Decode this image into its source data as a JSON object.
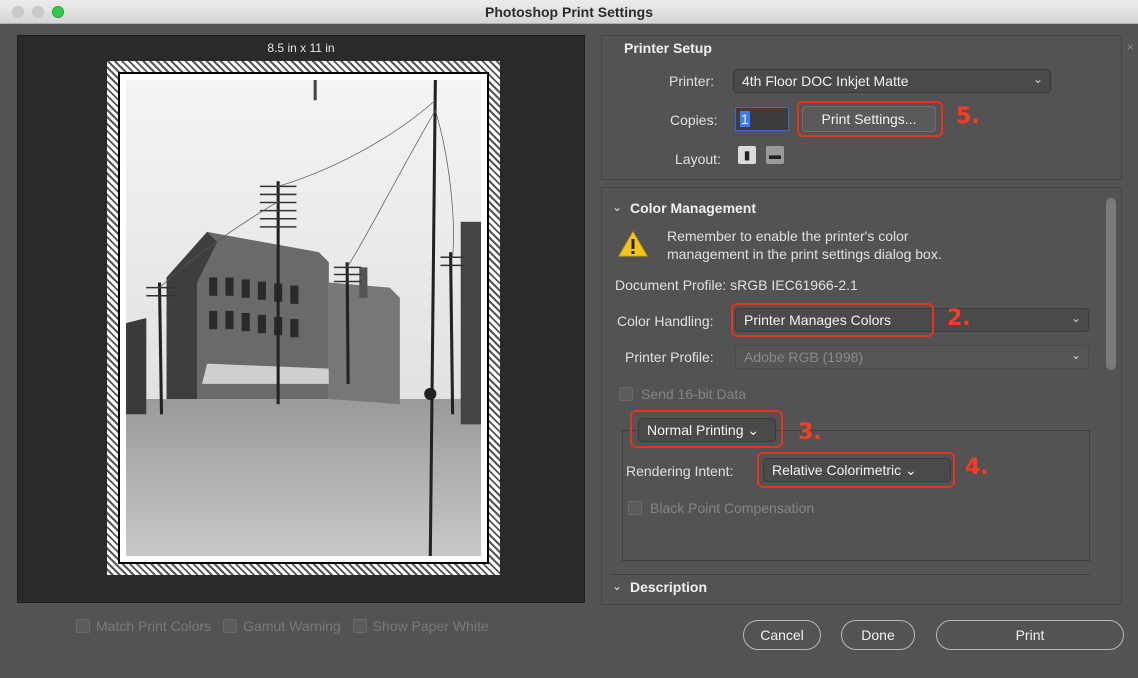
{
  "window": {
    "title": "Photoshop Print Settings"
  },
  "preview": {
    "paper_size": "8.5 in x 11 in"
  },
  "preview_options": [
    {
      "label": "Match Print Colors"
    },
    {
      "label": "Gamut Warning"
    },
    {
      "label": "Show Paper White"
    }
  ],
  "printer_setup": {
    "heading": "Printer Setup",
    "printer_label": "Printer:",
    "printer_value": "4th Floor DOC Inkjet Matte",
    "copies_label": "Copies:",
    "copies_value": "1",
    "print_settings_button": "Print Settings...",
    "layout_label": "Layout:"
  },
  "color_management": {
    "heading": "Color Management",
    "warning_text_1": "Remember to enable the printer's color",
    "warning_text_2": "management in the print settings dialog box.",
    "document_profile": "Document Profile: sRGB IEC61966-2.1",
    "color_handling_label": "Color Handling:",
    "color_handling_value": "Printer Manages Colors",
    "printer_profile_label": "Printer Profile:",
    "printer_profile_value": "Adobe RGB (1998)",
    "send_16bit_label": "Send 16-bit Data",
    "normal_printing_value": "Normal Printing",
    "rendering_intent_label": "Rendering Intent:",
    "rendering_intent_value": "Relative Colorimetric",
    "black_point_label": "Black Point Compensation"
  },
  "description": {
    "heading": "Description"
  },
  "annotations": {
    "step2": "2.",
    "step3": "3.",
    "step4": "4.",
    "step5": "5."
  },
  "buttons": {
    "cancel": "Cancel",
    "done": "Done",
    "print": "Print"
  },
  "colors": {
    "annotation": "#e8341c",
    "panel_bg": "#535353",
    "accent": "#3b7de9"
  }
}
